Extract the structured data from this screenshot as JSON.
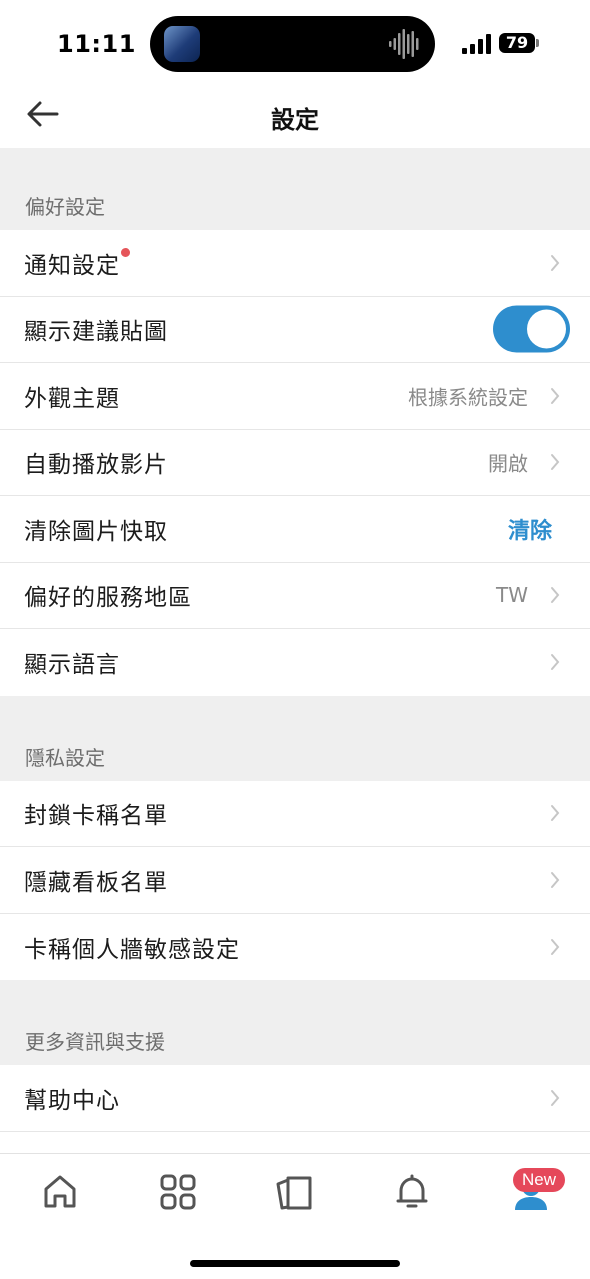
{
  "status_bar": {
    "time": "11:11",
    "battery": "79"
  },
  "header": {
    "title": "設定"
  },
  "sections": [
    {
      "title": "偏好設定",
      "rows": [
        {
          "label": "通知設定",
          "has_dot": true
        },
        {
          "label": "顯示建議貼圖",
          "toggle": "on"
        },
        {
          "label": "外觀主題",
          "value": "根據系統設定"
        },
        {
          "label": "自動播放影片",
          "value": "開啟"
        },
        {
          "label": "清除圖片快取",
          "action": "清除"
        },
        {
          "label": "偏好的服務地區",
          "value": "TW"
        },
        {
          "label": "顯示語言"
        }
      ]
    },
    {
      "title": "隱私設定",
      "rows": [
        {
          "label": "封鎖卡稱名單"
        },
        {
          "label": "隱藏看板名單"
        },
        {
          "label": "卡稱個人牆敏感設定"
        }
      ]
    },
    {
      "title": "更多資訊與支援",
      "rows": [
        {
          "label": "幫助中心"
        }
      ]
    }
  ],
  "tab_bar": {
    "tabs": [
      "home-icon",
      "apps-grid-icon",
      "boards-icon",
      "notification-bell-icon",
      "profile-icon"
    ],
    "badge": "New"
  },
  "colors": {
    "accent": "#2e8ece",
    "dot": "#e5555a",
    "badge": "#e5485a",
    "background": "#efefef"
  }
}
